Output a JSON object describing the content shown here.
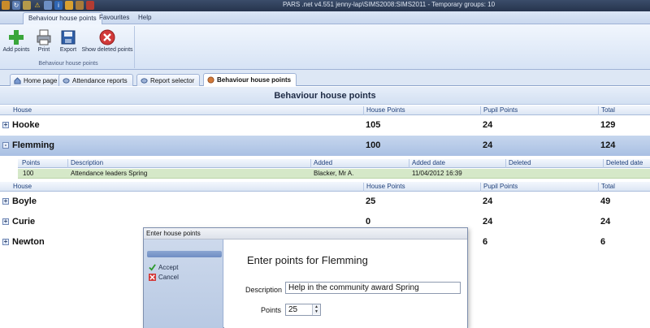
{
  "window": {
    "title": "PARS .net v4.551  jenny-lap\\SIMS2008:SIMS2011 - Temporary groups: 10"
  },
  "menu": {
    "tabs": [
      "Behaviour house points",
      "Favourites",
      "Help"
    ]
  },
  "ribbon": {
    "buttons": {
      "add": "Add points",
      "print": "Print",
      "export": "Export",
      "show_deleted": "Show deleted points"
    },
    "group_label": "Behaviour house points"
  },
  "doc_tabs": [
    "Home page",
    "Attendance reports",
    "Report selector",
    "Behaviour house points"
  ],
  "page": {
    "heading": "Behaviour house points"
  },
  "grid": {
    "headers": {
      "house": "House",
      "house_points": "House Points",
      "pupil_points": "Pupil Points",
      "total": "Total"
    },
    "rows": [
      {
        "house": "Hooke",
        "house_points": "105",
        "pupil_points": "24",
        "total": "129",
        "expander": "+"
      },
      {
        "house": "Flemming",
        "house_points": "100",
        "pupil_points": "24",
        "total": "124",
        "expander": "-"
      },
      {
        "house": "Boyle",
        "house_points": "25",
        "pupil_points": "24",
        "total": "49",
        "expander": "+"
      },
      {
        "house": "Curie",
        "house_points": "0",
        "pupil_points": "24",
        "total": "24",
        "expander": "+"
      },
      {
        "house": "Newton",
        "house_points": "",
        "pupil_points": "6",
        "total": "6",
        "expander": "+"
      }
    ],
    "sub_headers": {
      "points": "Points",
      "description": "Description",
      "added": "Added",
      "added_date": "Added date",
      "deleted": "Deleted",
      "deleted_date": "Deleted date"
    },
    "sub_rows": [
      {
        "points": "100",
        "description": "Attendance leaders Spring",
        "added": "Blacker, Mr A.",
        "added_date": "11/04/2012 16:39",
        "deleted": "",
        "deleted_date": ""
      }
    ]
  },
  "dialog": {
    "title": "Enter house points",
    "accept": "Accept",
    "cancel": "Cancel",
    "heading": "Enter points for Flemming",
    "description_label": "Description",
    "description_value": "Help in the community award Spring",
    "points_label": "Points",
    "points_value": "25"
  },
  "colors": {
    "selected_row": "#b5c9e8",
    "detail_row": "#d5e8c8",
    "titlebar": "#2f405e"
  }
}
